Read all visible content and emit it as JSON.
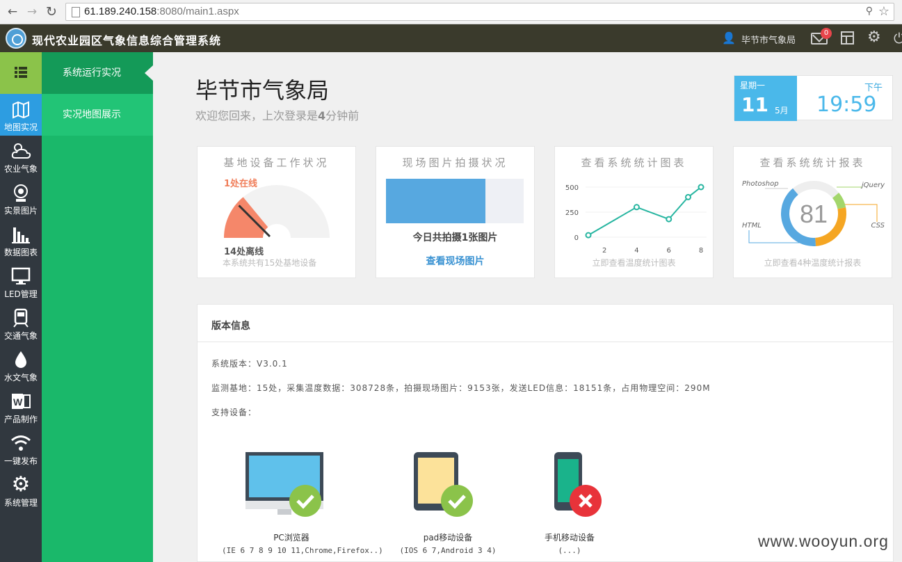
{
  "browser": {
    "url_host": "61.189.240.158",
    "url_rest": ":8080/main1.aspx"
  },
  "header": {
    "title": "现代农业园区气象信息综合管理系统",
    "user_name": "毕节市气象局",
    "mail_count": "0"
  },
  "sidebar": {
    "items": [
      {
        "label": "地图实况",
        "icon": "map-icon"
      },
      {
        "label": "农业气象",
        "icon": "cloud-sun-icon"
      },
      {
        "label": "实景图片",
        "icon": "camera-icon"
      },
      {
        "label": "数据图表",
        "icon": "bar-chart-icon"
      },
      {
        "label": "LED管理",
        "icon": "monitor-icon"
      },
      {
        "label": "交通气象",
        "icon": "train-icon"
      },
      {
        "label": "水文气象",
        "icon": "water-drop-icon"
      },
      {
        "label": "产品制作",
        "icon": "word-doc-icon"
      },
      {
        "label": "一键发布",
        "icon": "wifi-icon"
      },
      {
        "label": "系统管理",
        "icon": "gear-icon"
      }
    ]
  },
  "submenu": {
    "items": [
      "系统运行实况",
      "实况地图展示"
    ]
  },
  "main": {
    "title": "毕节市气象局",
    "welcome_prefix": "欢迎您回来，上次登录是",
    "welcome_bold": "4",
    "welcome_suffix": "分钟前"
  },
  "datebox": {
    "weekday": "星期一",
    "day": "11",
    "month": "5月",
    "ampm": "下午",
    "time": "19:59"
  },
  "cards": {
    "devices": {
      "title": "基地设备工作状况",
      "online_label": "1处在线",
      "offline_label": "14处离线",
      "total_label": "本系统共有15处基地设备",
      "online": 1,
      "total": 15
    },
    "photos": {
      "title": "现场图片拍摄状况",
      "count_label": "今日共拍摄1张图片",
      "link_label": "查看现场图片",
      "fill_fraction": 0.72
    },
    "line_chart": {
      "title": "查看系统统计图表",
      "foot": "立即查看温度统计图表"
    },
    "donut": {
      "title": "查看系统统计报表",
      "foot": "立即查看4种温度统计报表",
      "center_value": "81",
      "colors": {
        "Photoshop": "#eeeeee",
        "jQuery": "#a3d66b",
        "CSS": "#f5a623",
        "HTML": "#57a8e0"
      }
    }
  },
  "chart_data": [
    {
      "type": "line",
      "x": [
        1,
        4,
        6,
        7.2,
        8
      ],
      "y": [
        20,
        300,
        180,
        400,
        500
      ],
      "xticks": [
        "2",
        "4",
        "6",
        "8"
      ],
      "yticks": [
        "500",
        "250",
        "0"
      ],
      "xlim": [
        1,
        8
      ],
      "ylim": [
        0,
        500
      ],
      "grid": true,
      "color": "#26b5a0"
    },
    {
      "type": "pie",
      "labels": [
        "Photoshop",
        "jQuery",
        "CSS",
        "HTML"
      ],
      "values": [
        25,
        8,
        27,
        40
      ],
      "center_text": "81"
    }
  ],
  "version": {
    "title": "版本信息",
    "line1": "系统版本：V3.0.1",
    "line2": "监测基地：15处，采集温度数据：308728条，拍摄现场图片：9153张，发送LED信息：18151条，占用物理空间：290M",
    "line3": "支持设备：",
    "devices": [
      {
        "label": "PC浏览器",
        "sub": "(IE 6 7 8 9 10 11,Chrome,Firefox..)",
        "supported": true
      },
      {
        "label": "pad移动设备",
        "sub": "(IOS 6 7,Android 3 4)",
        "supported": true
      },
      {
        "label": "手机移动设备",
        "sub": "(...)",
        "supported": false
      }
    ]
  },
  "watermark": "www.wooyun.org"
}
